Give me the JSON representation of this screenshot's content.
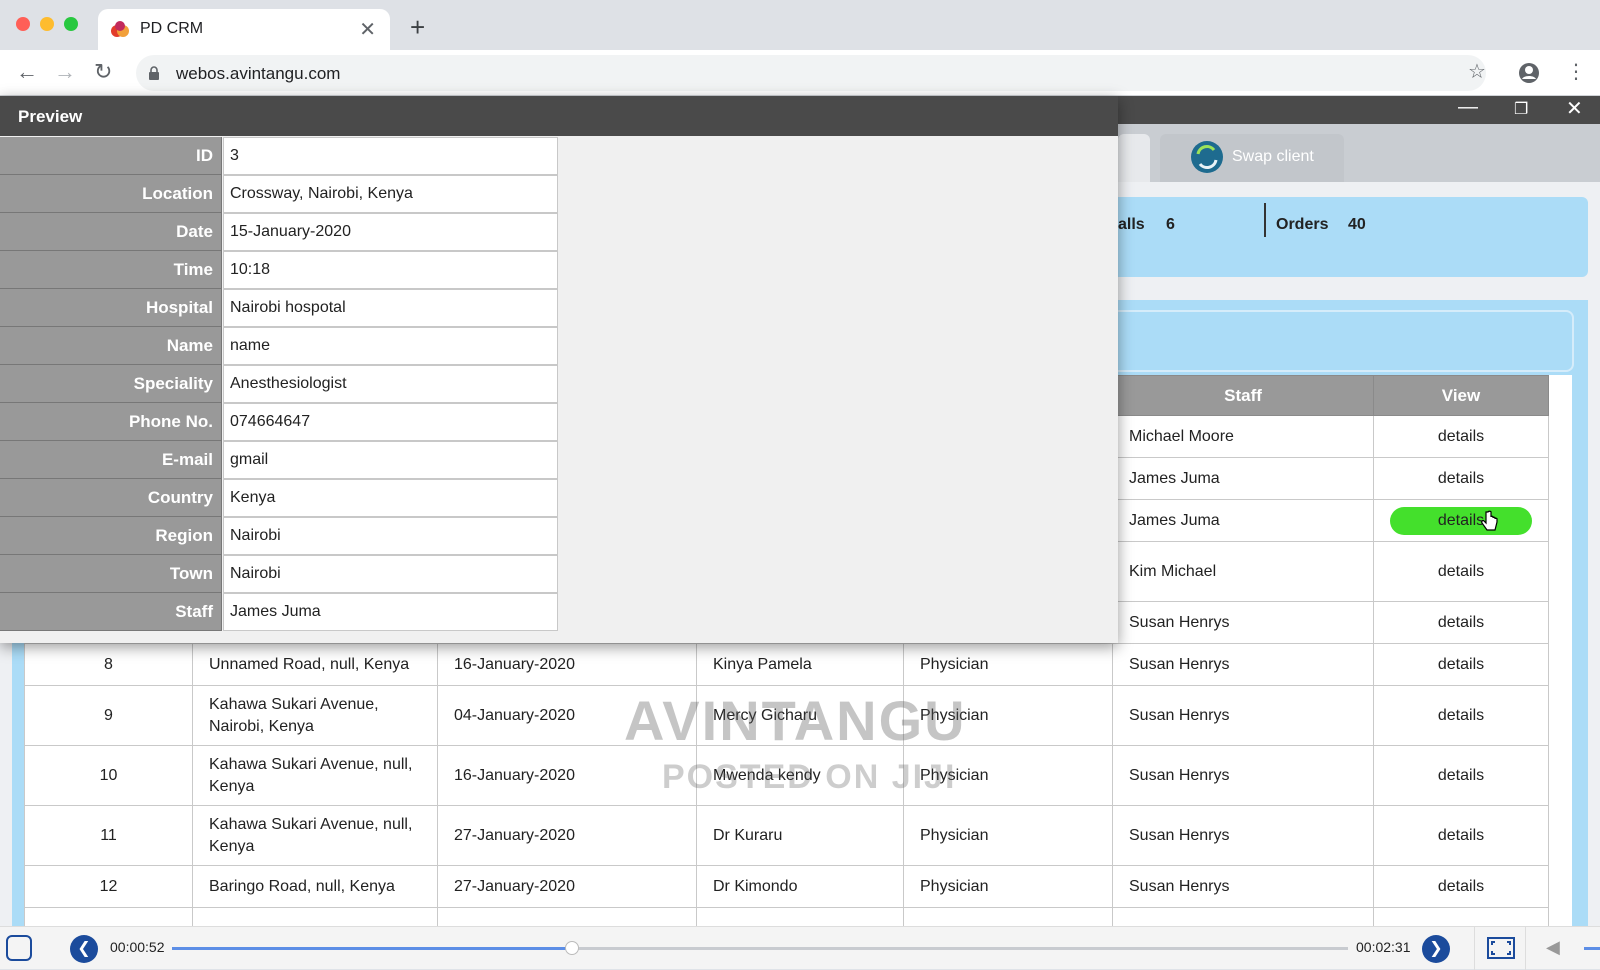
{
  "browser": {
    "tab_title": "PD CRM",
    "url": "webos.avintangu.com"
  },
  "app": {
    "swap_client_label": "Swap client",
    "stats": {
      "calls_label": "alls",
      "calls_value": "6",
      "orders_label": "Orders",
      "orders_value": "40"
    },
    "table": {
      "headers": {
        "staff": "Staff",
        "view": "View"
      },
      "top_rows": [
        {
          "staff": "Michael Moore",
          "view": "details"
        },
        {
          "staff": "James Juma",
          "view": "details"
        },
        {
          "staff": "James Juma",
          "view": "details"
        },
        {
          "staff": "Kim Michael",
          "view": "details"
        },
        {
          "staff": "Susan Henrys",
          "view": "details"
        }
      ],
      "rows": [
        {
          "id": "8",
          "location": "Unnamed Road, null, Kenya",
          "date": "16-January-2020",
          "name": "Kinya Pamela",
          "speciality": "Physician",
          "staff": "Susan Henrys",
          "view": "details"
        },
        {
          "id": "9",
          "location": "Kahawa Sukari Avenue, Nairobi, Kenya",
          "date": "04-January-2020",
          "name": "Mercy Gicharu",
          "speciality": "Physician",
          "staff": "Susan Henrys",
          "view": "details"
        },
        {
          "id": "10",
          "location": "Kahawa Sukari Avenue, null, Kenya",
          "date": "16-January-2020",
          "name": "Mwenda kendy",
          "speciality": "Physician",
          "staff": "Susan Henrys",
          "view": "details"
        },
        {
          "id": "11",
          "location": "Kahawa Sukari Avenue, null, Kenya",
          "date": "27-January-2020",
          "name": "Dr Kuraru",
          "speciality": "Physician",
          "staff": "Susan Henrys",
          "view": "details"
        },
        {
          "id": "12",
          "location": "Baringo Road, null, Kenya",
          "date": "27-January-2020",
          "name": "Dr Kimondo",
          "speciality": "Physician",
          "staff": "Susan Henrys",
          "view": "details"
        }
      ]
    },
    "watermark": {
      "line1": "AVINTANGU",
      "line2": "POSTED ON JIJI"
    }
  },
  "preview": {
    "title": "Preview",
    "fields": [
      {
        "label": "ID",
        "value": "3"
      },
      {
        "label": "Location",
        "value": "Crossway, Nairobi, Kenya"
      },
      {
        "label": "Date",
        "value": "15-January-2020"
      },
      {
        "label": "Time",
        "value": "10:18"
      },
      {
        "label": "Hospital",
        "value": "Nairobi hospotal"
      },
      {
        "label": "Name",
        "value": "name"
      },
      {
        "label": "Speciality",
        "value": "Anesthesiologist"
      },
      {
        "label": "Phone No.",
        "value": "074664647"
      },
      {
        "label": "E-mail",
        "value": "gmail"
      },
      {
        "label": "Country",
        "value": "Kenya"
      },
      {
        "label": "Region",
        "value": "Nairobi"
      },
      {
        "label": "Town",
        "value": "Nairobi"
      },
      {
        "label": "Staff",
        "value": "James Juma"
      }
    ]
  },
  "video": {
    "elapsed": "00:00:52",
    "total": "00:02:31",
    "progress": 0.34
  },
  "colors": {
    "accent_green": "#44e02c",
    "panel_blue": "#abdcf7",
    "header_gray": "#999999",
    "titlebar_dark": "#4a4a4a"
  }
}
